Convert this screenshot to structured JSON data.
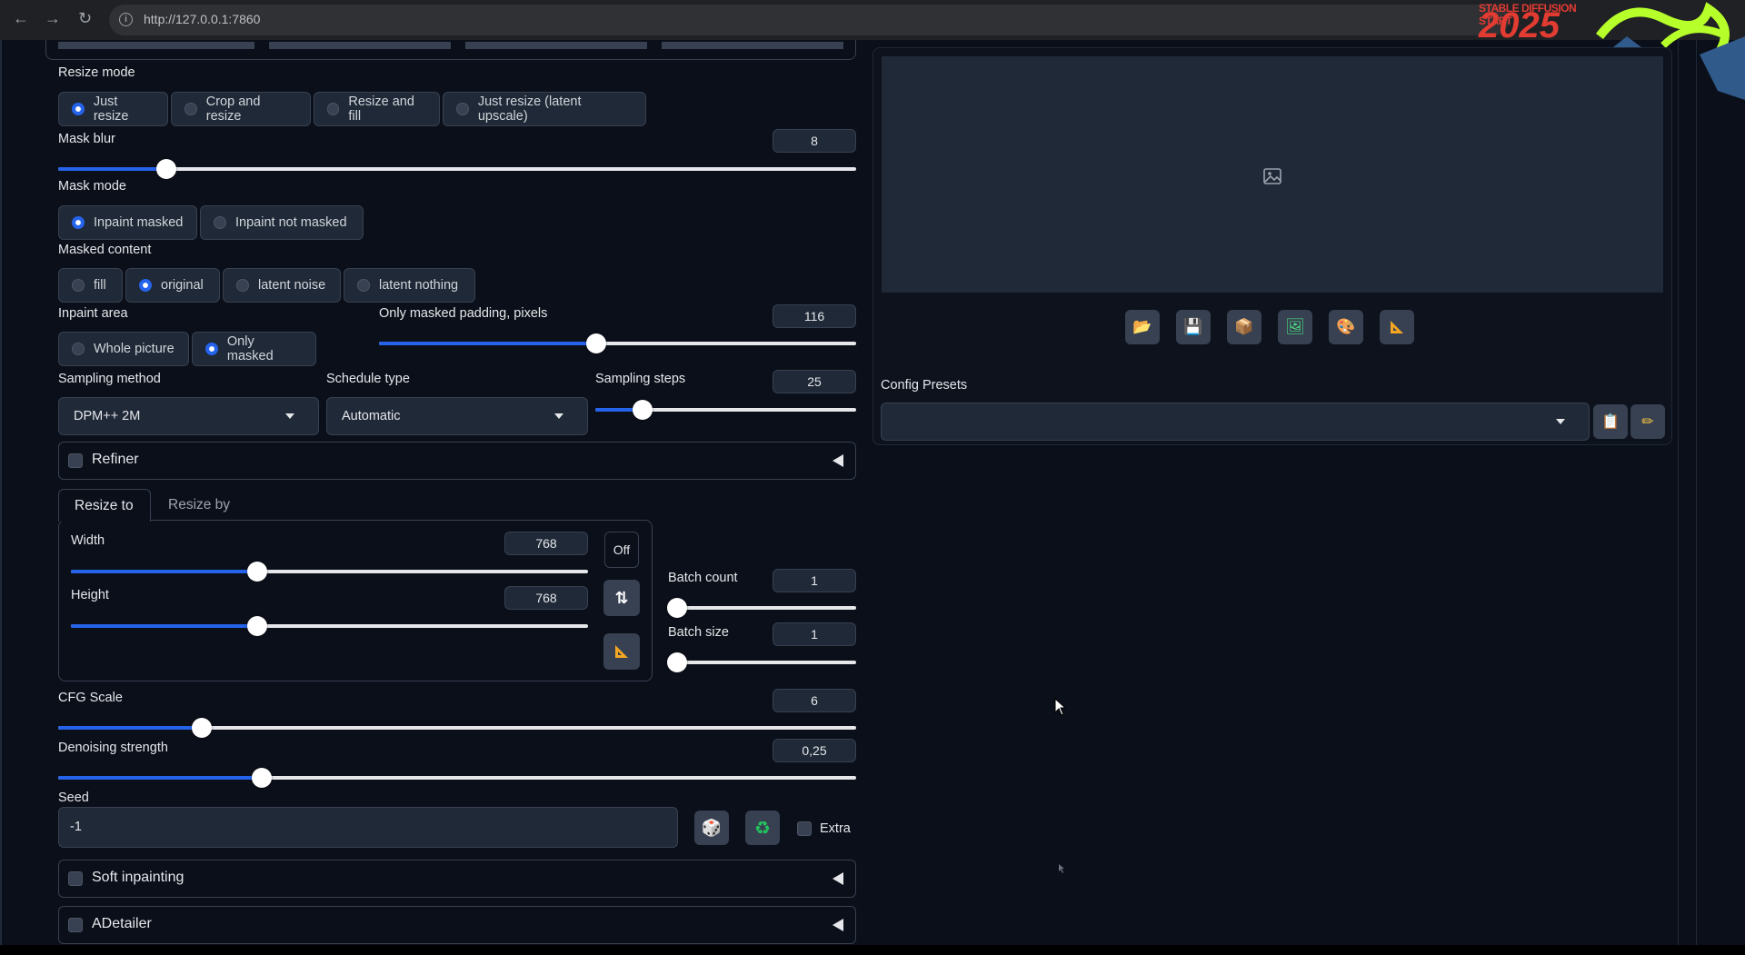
{
  "browser": {
    "url": "http://127.0.0.1:7860"
  },
  "logo": {
    "top_text": "STABLE DIFFUSION START",
    "year": "2025"
  },
  "resize_mode": {
    "label": "Resize mode",
    "options": [
      "Just resize",
      "Crop and resize",
      "Resize and fill",
      "Just resize (latent upscale)"
    ],
    "selected": "Just resize"
  },
  "mask_blur": {
    "label": "Mask blur",
    "value": "8",
    "fraction": 0.135
  },
  "mask_mode": {
    "label": "Mask mode",
    "options": [
      "Inpaint masked",
      "Inpaint not masked"
    ],
    "selected": "Inpaint masked"
  },
  "masked_content": {
    "label": "Masked content",
    "options": [
      "fill",
      "original",
      "latent noise",
      "latent nothing"
    ],
    "selected": "original"
  },
  "inpaint_area": {
    "label": "Inpaint area",
    "options": [
      "Whole picture",
      "Only masked"
    ],
    "selected": "Only masked"
  },
  "masked_padding": {
    "label": "Only masked padding, pixels",
    "value": "116",
    "fraction": 0.455
  },
  "sampling_method": {
    "label": "Sampling method",
    "value": "DPM++ 2M"
  },
  "schedule_type": {
    "label": "Schedule type",
    "value": "Automatic"
  },
  "sampling_steps": {
    "label": "Sampling steps",
    "value": "25",
    "fraction": 0.18
  },
  "refiner": {
    "label": "Refiner"
  },
  "size_tabs": [
    "Resize to",
    "Resize by"
  ],
  "width": {
    "label": "Width",
    "value": "768",
    "fraction": 0.36
  },
  "height": {
    "label": "Height",
    "value": "768",
    "fraction": 0.36
  },
  "off_button": "Off",
  "batch_count": {
    "label": "Batch count",
    "value": "1",
    "fraction": 0.0
  },
  "batch_size": {
    "label": "Batch size",
    "value": "1",
    "fraction": 0.0
  },
  "cfg_scale": {
    "label": "CFG Scale",
    "value": "6",
    "fraction": 0.18
  },
  "denoising": {
    "label": "Denoising strength",
    "value": "0,25",
    "fraction": 0.255
  },
  "seed": {
    "label": "Seed",
    "value": "-1",
    "extra_label": "Extra"
  },
  "soft_inpainting": {
    "label": "Soft inpainting"
  },
  "adetailer": {
    "label": "ADetailer"
  },
  "config_presets": {
    "label": "Config Presets",
    "value": ""
  },
  "output_tools": [
    "folder-icon",
    "save-icon",
    "zip-icon",
    "send-to-img2img-icon",
    "send-to-inpaint-icon",
    "send-to-extras-icon"
  ]
}
